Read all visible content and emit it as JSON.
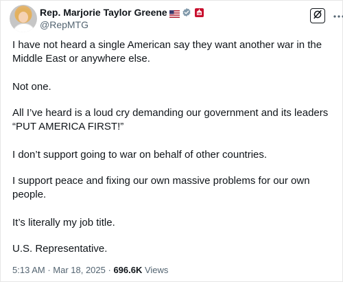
{
  "author": {
    "display_name": "Rep. Marjorie Taylor Greene",
    "handle": "@RepMTG",
    "badges": [
      "us-flag-icon",
      "verified-badge-icon",
      "affiliation-badge-icon"
    ],
    "verified_color": "#829aab",
    "affiliation_color": "#c8102e"
  },
  "actions": {
    "grok_icon": "grok-icon",
    "more_icon": "more-options-icon"
  },
  "tweet": {
    "paragraphs": [
      "I have not heard a single American say they want another war in the Middle East or anywhere else.",
      "Not one.",
      "All I’ve heard is a loud cry demanding our government and its leaders “PUT AMERICA FIRST!”",
      "I don’t support going to war on behalf of other countries.",
      "I support peace and fixing our own massive problems for our own people.",
      "It’s literally my job title.",
      "U.S. Representative."
    ]
  },
  "meta": {
    "time": "5:13 AM",
    "separator": " · ",
    "date": "Mar 18, 2025",
    "views_count": "696.6K",
    "views_label": " Views"
  }
}
